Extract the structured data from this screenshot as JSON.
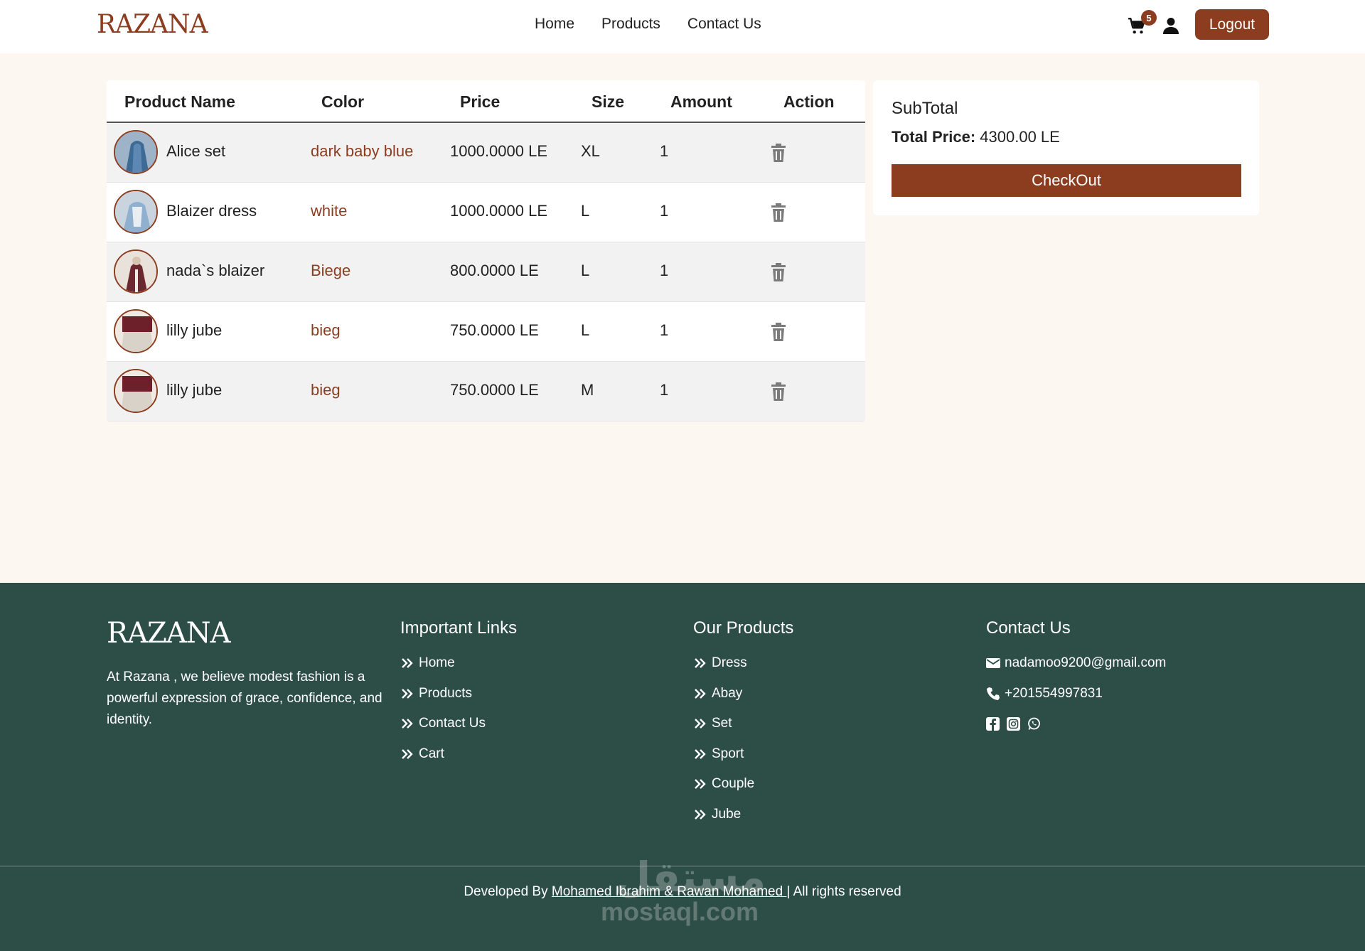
{
  "brand": {
    "name": "RAZANA",
    "accent": "#8c3d20",
    "footer_bg": "#2d4e47"
  },
  "nav": {
    "links": [
      "Home",
      "Products",
      "Contact Us"
    ],
    "cart_count": "5",
    "logout_label": "Logout"
  },
  "table": {
    "headers": [
      "Product Name",
      "Color",
      "Price",
      "Size",
      "Amount",
      "Action"
    ],
    "rows": [
      {
        "name": "Alice set",
        "color": "dark baby blue",
        "price": "1000.0000 LE",
        "size": "XL",
        "amount": "1",
        "thumb_tone": "blue"
      },
      {
        "name": "Blaizer dress",
        "color": "white",
        "price": "1000.0000 LE",
        "size": "L",
        "amount": "1",
        "thumb_tone": "lightblue"
      },
      {
        "name": "nada`s blaizer",
        "color": "Biege",
        "price": "800.0000 LE",
        "size": "L",
        "amount": "1",
        "thumb_tone": "maroon"
      },
      {
        "name": "lilly jube",
        "color": "bieg",
        "price": "750.0000 LE",
        "size": "L",
        "amount": "1",
        "thumb_tone": "burgundy"
      },
      {
        "name": "lilly jube",
        "color": "bieg",
        "price": "750.0000 LE",
        "size": "M",
        "amount": "1",
        "thumb_tone": "burgundy"
      }
    ]
  },
  "subtotal": {
    "title": "SubTotal",
    "total_label": "Total Price:",
    "total_value": " 4300.00 LE",
    "checkout_label": "CheckOut"
  },
  "footer": {
    "logo": "RAZANA",
    "description": "At Razana , we believe modest fashion is a powerful expression of grace, confidence, and identity.",
    "important_links": {
      "title": "Important Links",
      "items": [
        "Home",
        "Products",
        "Contact Us",
        "Cart"
      ]
    },
    "our_products": {
      "title": "Our Products",
      "items": [
        "Dress",
        "Abay",
        "Set",
        "Sport",
        "Couple",
        "Jube"
      ]
    },
    "contact": {
      "title": "Contact Us",
      "email": "nadamoo9200@gmail.com",
      "phone": "+201554997831"
    },
    "credit": {
      "prefix": "Developed By ",
      "dev1": "Mohamed Ibrahim ",
      "and": "& ",
      "dev2": "Rawan Mohamed ",
      "suffix": "| All rights reserved"
    },
    "watermark": {
      "arabic": "مستقل",
      "latin": "mostaql.com"
    }
  }
}
